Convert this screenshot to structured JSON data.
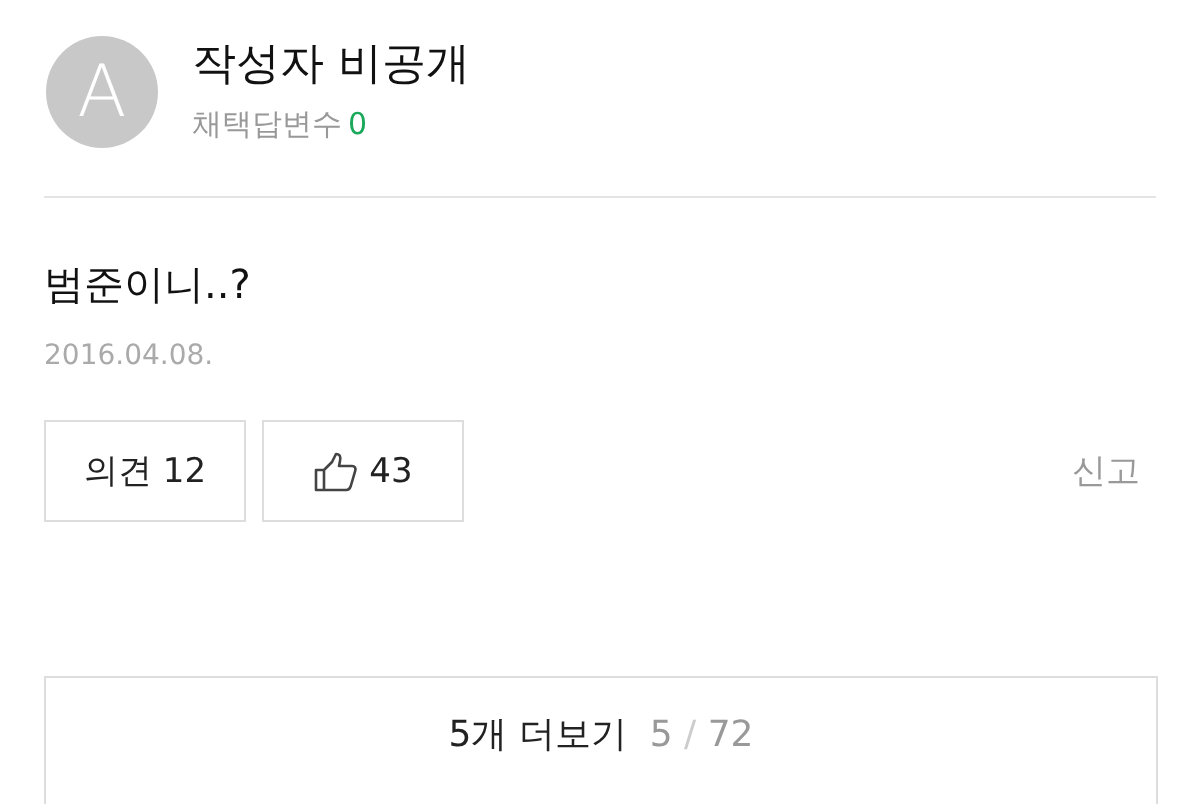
{
  "author": {
    "avatar_letter": "A",
    "name": "작성자 비공개",
    "adopted_label": "채택답변수",
    "adopted_count": "0"
  },
  "answer": {
    "text": "범준이니..?",
    "date": "2016.04.08."
  },
  "actions": {
    "comments": {
      "label": "의견",
      "count": "12"
    },
    "likes": {
      "count": "43"
    },
    "report": "신고"
  },
  "more": {
    "label": "5개 더보기",
    "current": "5",
    "separator": "/",
    "total": "72"
  }
}
